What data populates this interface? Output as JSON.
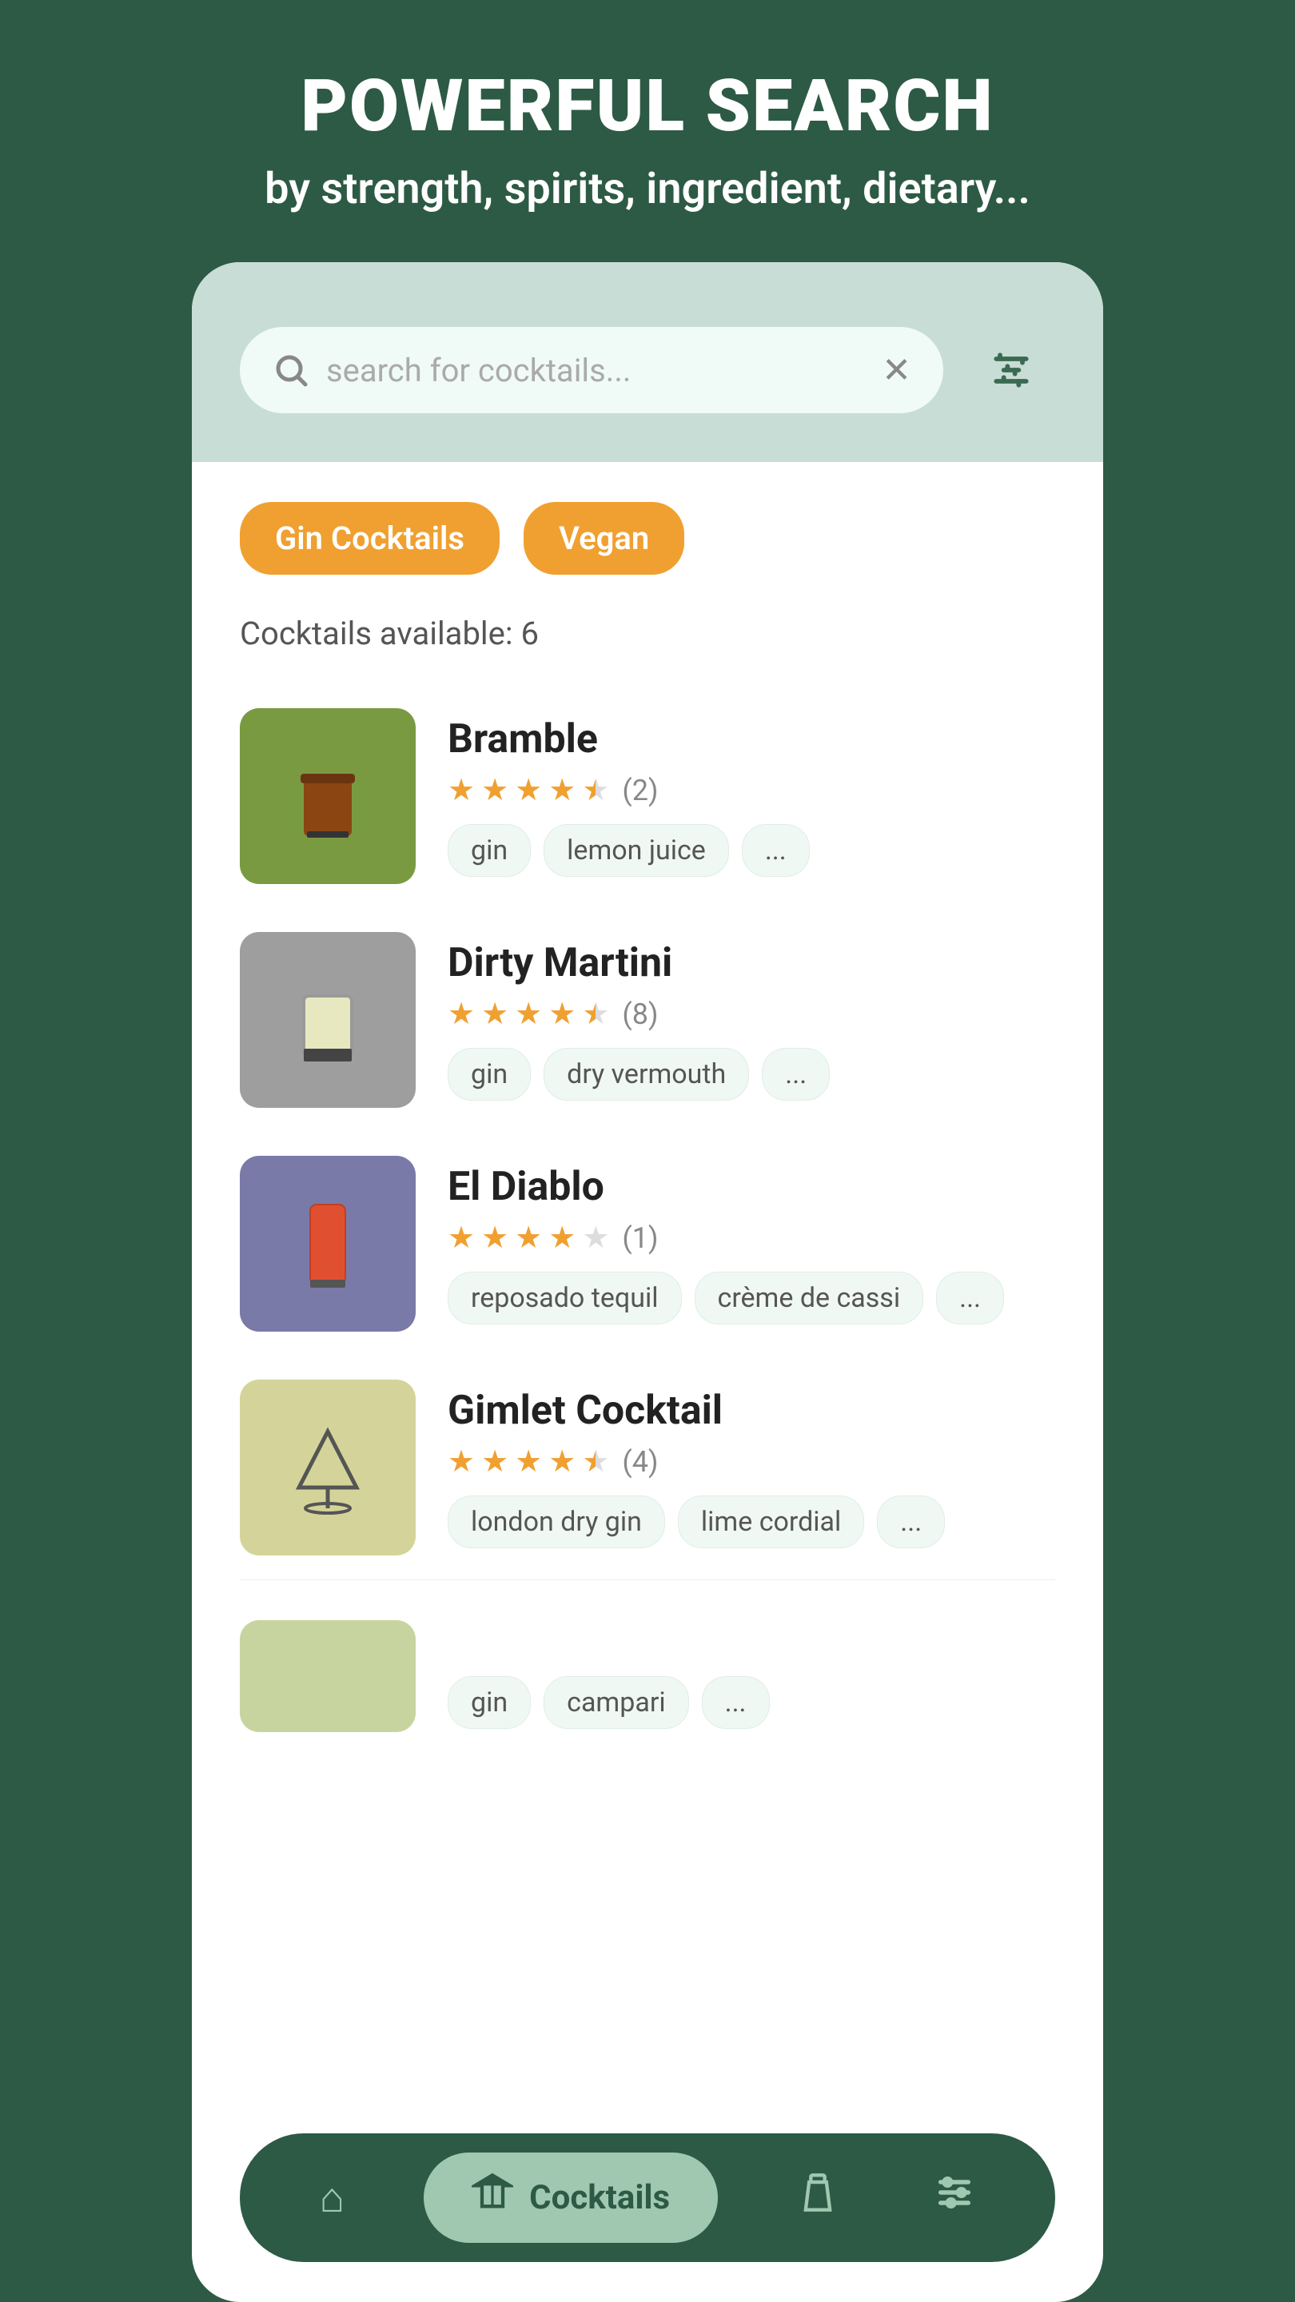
{
  "header": {
    "title": "POWERFUL SEARCH",
    "subtitle": "by strength, spirits, ingredient, dietary..."
  },
  "search": {
    "placeholder": "search for cocktails..."
  },
  "tags": [
    {
      "label": "Gin Cocktails"
    },
    {
      "label": "Vegan"
    }
  ],
  "available": {
    "text": "Cocktails available:",
    "count": "6"
  },
  "cocktails": [
    {
      "name": "Bramble",
      "stars": 4.5,
      "rating_count": "(2)",
      "ingredients": [
        "gin",
        "lemon juice",
        "..."
      ],
      "thumb_color": "#7a9a42",
      "glass": "tumbler"
    },
    {
      "name": "Dirty Martini",
      "stars": 4.5,
      "rating_count": "(8)",
      "ingredients": [
        "gin",
        "dry vermouth",
        "..."
      ],
      "thumb_color": "#9e9e9e",
      "glass": "tumbler"
    },
    {
      "name": "El Diablo",
      "stars": 4.0,
      "rating_count": "(1)",
      "ingredients": [
        "reposado tequil",
        "crème de cassi",
        "..."
      ],
      "thumb_color": "#7a7aa8",
      "glass": "tall"
    },
    {
      "name": "Gimlet Cocktail",
      "stars": 4.5,
      "rating_count": "(4)",
      "ingredients": [
        "london dry gin",
        "lime cordial",
        "..."
      ],
      "thumb_color": "#d4d49a",
      "glass": "martini"
    }
  ],
  "nav": {
    "items": [
      {
        "icon": "🏠",
        "label": "Home",
        "active": false
      },
      {
        "icon": "🍸",
        "label": "Cocktails",
        "active": true
      },
      {
        "icon": "🍾",
        "label": "Spirits",
        "active": false
      },
      {
        "icon": "≡",
        "label": "Filter",
        "active": false
      }
    ]
  },
  "partial_cocktail": {
    "ingredients": [
      "gin",
      "campari",
      "..."
    ]
  }
}
